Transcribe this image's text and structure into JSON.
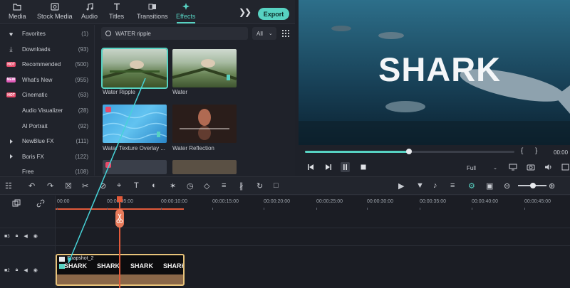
{
  "top_tabs": [
    {
      "label": "Media",
      "icon": "folder-icon"
    },
    {
      "label": "Stock Media",
      "icon": "stock-media-icon"
    },
    {
      "label": "Audio",
      "icon": "music-note-icon"
    },
    {
      "label": "Titles",
      "icon": "text-t-icon"
    },
    {
      "label": "Transitions",
      "icon": "transitions-icon"
    },
    {
      "label": "Effects",
      "icon": "effects-sparkle-icon",
      "active": true
    }
  ],
  "export_label": "Export",
  "sidebar": [
    {
      "label": "Favorites",
      "count": "(1)",
      "lead": "heart"
    },
    {
      "label": "Downloads",
      "count": "(93)",
      "lead": "download"
    },
    {
      "label": "Recommended",
      "count": "(500)",
      "lead": "hot"
    },
    {
      "label": "What's New",
      "count": "(955)",
      "lead": "new"
    },
    {
      "label": "Cinematic",
      "count": "(63)",
      "lead": "hot"
    },
    {
      "label": "Audio Visualizer",
      "count": "(28)",
      "lead": ""
    },
    {
      "label": "AI Portrait",
      "count": "(92)",
      "lead": ""
    },
    {
      "label": "NewBlue FX",
      "count": "(111)",
      "lead": "caret"
    },
    {
      "label": "Boris FX",
      "count": "(122)",
      "lead": "caret"
    },
    {
      "label": "Free",
      "count": "(108)",
      "lead": ""
    }
  ],
  "search": {
    "value": "WATER ripple"
  },
  "filter_label": "All",
  "effects": [
    {
      "label": "Water Ripple",
      "selected": true
    },
    {
      "label": "Water",
      "selected": false
    },
    {
      "label": "Water Texture Overlay ...",
      "selected": false
    },
    {
      "label": "Water Reflection",
      "selected": false
    }
  ],
  "preview": {
    "title_text": "SHARK",
    "progress": 0.5,
    "timecode": "00:00",
    "quality": "Full"
  },
  "ruler_labels": [
    "00:00",
    "00:00:05:00",
    "00:00:10:00",
    "00:00:15:00",
    "00:00:20:00",
    "00:00:25:00",
    "00:00:30:00",
    "00:00:35:00",
    "00:00:40:00",
    "00:00:45:00"
  ],
  "tracks": [
    {
      "num": "3"
    },
    {
      "num": "2"
    }
  ],
  "clip": {
    "name": "Snapshot_2",
    "words": [
      "SHARK",
      "SHARK",
      "SHARK",
      "SHARK"
    ]
  },
  "colors": {
    "accent": "#57d2c2",
    "playhead": "#e25a3a",
    "clip_border": "#e8c37a"
  }
}
